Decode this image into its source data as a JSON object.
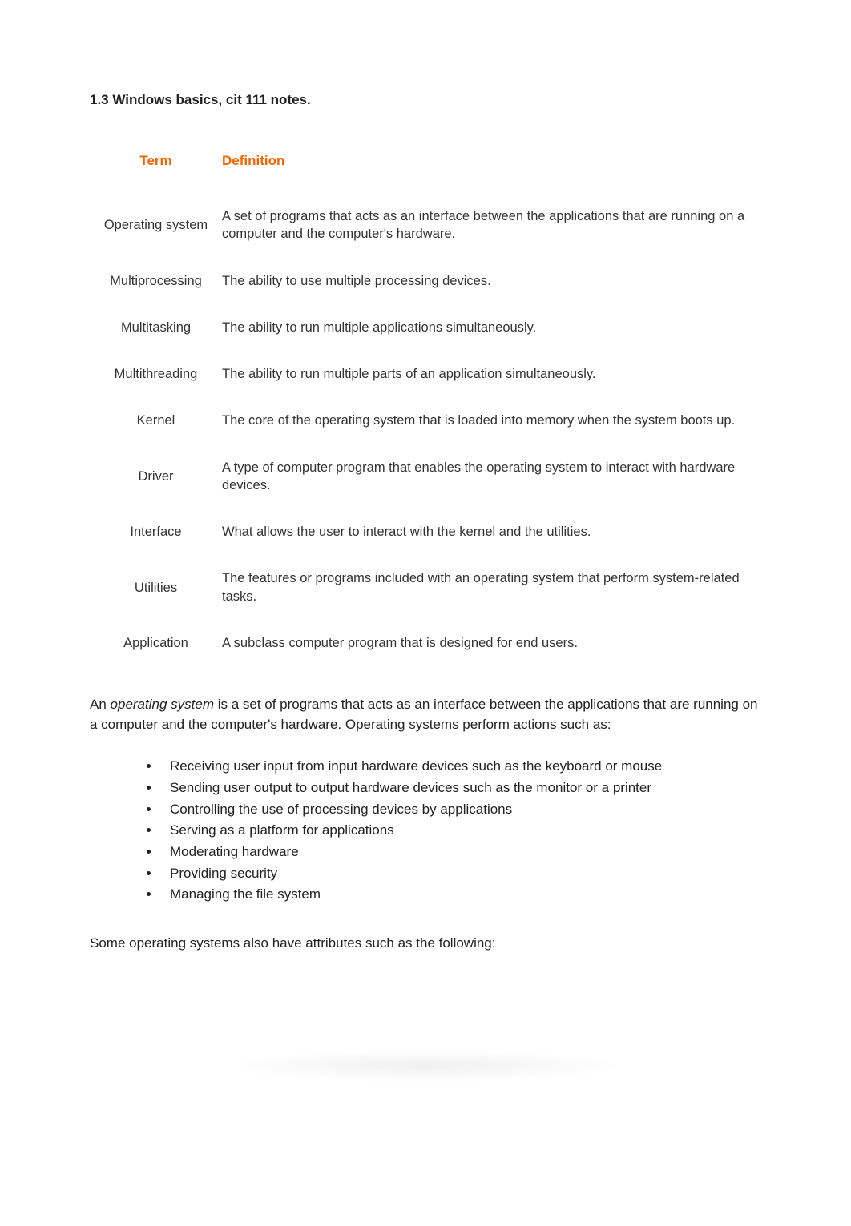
{
  "title": "1.3 Windows basics, cit 111 notes.",
  "table": {
    "headers": {
      "term": "Term",
      "definition": "Definition"
    },
    "rows": [
      {
        "term": "Operating system",
        "definition": "A set of programs that acts as an interface between the applications that are running on a computer and the computer's hardware."
      },
      {
        "term": "Multiprocessing",
        "definition": "The ability to use multiple processing devices."
      },
      {
        "term": "Multitasking",
        "definition": "The ability to run multiple applications simultaneously."
      },
      {
        "term": "Multithreading",
        "definition": "The ability to run multiple parts of an application simultaneously."
      },
      {
        "term": "Kernel",
        "definition": "The core of the operating system that is loaded into memory when the system boots up."
      },
      {
        "term": "Driver",
        "definition": "A type of computer program that enables the operating system to interact with hardware devices."
      },
      {
        "term": "Interface",
        "definition": "What allows the user to interact with the kernel and the utilities."
      },
      {
        "term": "Utilities",
        "definition": "The features or programs included with an operating system that perform system-related tasks."
      },
      {
        "term": "Application",
        "definition": "A subclass computer program that is designed for end users."
      }
    ]
  },
  "paragraph1_prefix": "An ",
  "paragraph1_em": "operating system",
  "paragraph1_suffix": " is a set of programs that acts as an interface between the applications that are running on a computer and the computer's hardware. Operating systems perform actions such as:",
  "actions": [
    "Receiving user input from input hardware devices such as the keyboard or mouse",
    "Sending user output to output hardware devices such as the monitor or a printer",
    "Controlling the use of processing devices by applications",
    "Serving as a platform for applications",
    "Moderating hardware",
    "Providing security",
    "Managing the file system"
  ],
  "paragraph2": "Some operating systems also have attributes such as the following:"
}
